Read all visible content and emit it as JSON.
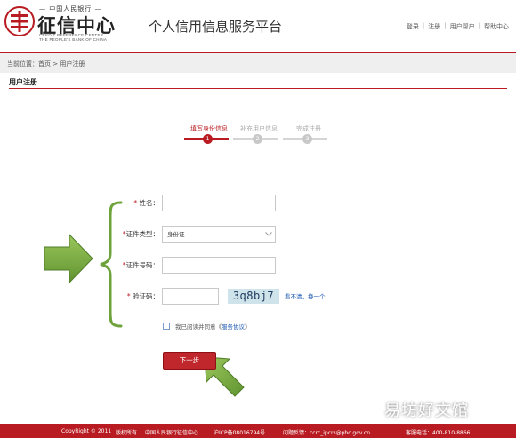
{
  "header": {
    "logo_top": "— 中国人民银行 —",
    "logo_main": "征信中心",
    "logo_en_1": "CREDIT REFERENCE CENTER",
    "logo_en_2": "THE PEOPLE'S BANK OF CHINA",
    "platform_title": "个人信用信息服务平台",
    "links": [
      "登录",
      "注册",
      "用户帮户",
      "帮助中心"
    ],
    "link_separator": "|"
  },
  "breadcrumb": "当前位置：首页 > 用户注册",
  "section_title": "用户注册",
  "steps": [
    {
      "label": "填写身份信息",
      "num": "1",
      "active": true
    },
    {
      "label": "补充用户信息",
      "num": "2",
      "active": false
    },
    {
      "label": "完成注册",
      "num": "3",
      "active": false
    }
  ],
  "form": {
    "name_label": "姓名：",
    "id_type_label": "证件类型：",
    "id_type_value": "身份证",
    "id_number_label": "证件号码：",
    "captcha_label": "验证码：",
    "captcha_text": "3q8bj7",
    "captcha_refresh": "看不清，换一个",
    "required_mark": "*",
    "agree_text": "我已阅读并同意《",
    "agree_link": "服务协议",
    "agree_end": "》",
    "next_button": "下一步"
  },
  "footer": {
    "copyright": "CopyRight © 2011",
    "rights": "版权所有",
    "org": "中国人民银行征信中心",
    "icp": "沪ICP备08016794号",
    "feedback": "问题反馈：ccrc_ipcrs@pbc.gov.cn",
    "phone": "客服电话：400-810-8866"
  },
  "watermark": "易坊好文馆",
  "colors": {
    "brand_red": "#b81c22",
    "arrow_green": "#7db043",
    "link_blue": "#1a56b0"
  }
}
